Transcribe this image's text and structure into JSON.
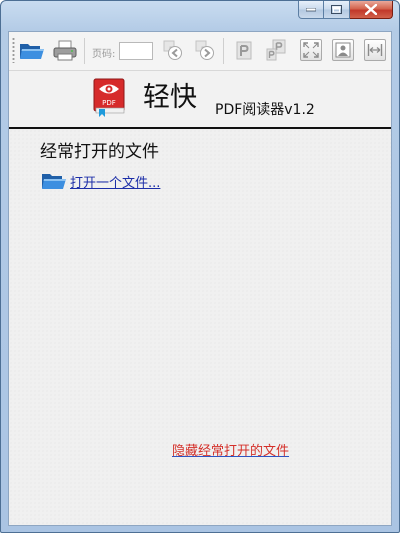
{
  "window": {
    "controls": {
      "minimize_icon": "minimize-icon",
      "maximize_icon": "maximize-icon",
      "close_icon": "close-icon"
    }
  },
  "toolbar": {
    "open_icon": "folder-open-icon",
    "print_icon": "printer-icon",
    "page_label": "页码:",
    "page_value": "",
    "prev_icon": "previous-page-icon",
    "next_icon": "next-page-icon",
    "single_page_icon": "single-page-icon",
    "continuous_icon": "continuous-page-icon",
    "fullscreen_icon": "fullscreen-icon",
    "fit_page_icon": "fit-page-icon",
    "fit_width_icon": "fit-width-icon"
  },
  "header": {
    "logo_icon": "pdf-book-logo-icon",
    "logo_text": "PDF",
    "brand": "轻快",
    "subtitle": "PDF阅读器v1.2"
  },
  "recent": {
    "title": "经常打开的文件",
    "open_file_label": "打开一个文件...",
    "hide_label": "隐藏经常打开的文件"
  },
  "colors": {
    "link_blue": "#1c2ea8",
    "hide_link_red": "#d4302a",
    "logo_red": "#d62b2b",
    "folder_blue": "#2f7fd0"
  }
}
